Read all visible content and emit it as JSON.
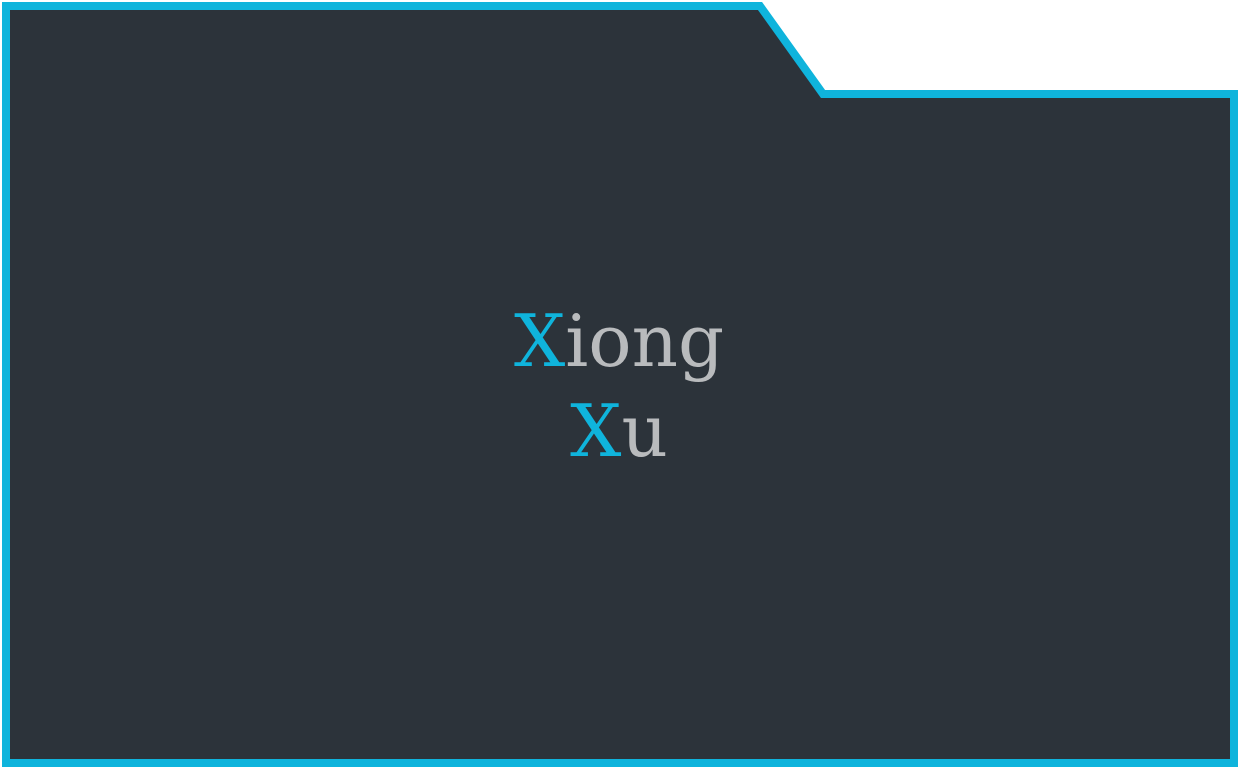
{
  "name": {
    "first": {
      "initial": "X",
      "rest": "iong"
    },
    "last": {
      "initial": "X",
      "rest": "u"
    }
  },
  "colors": {
    "panel_background": "#2c333a",
    "border_accent": "#0fb4dc",
    "text_primary": "#b9bbbd",
    "initial_accent": "#0fb4dc",
    "page_background": "#ffffff"
  },
  "icons": {
    "panel_shape": "folder-tab-panel"
  }
}
